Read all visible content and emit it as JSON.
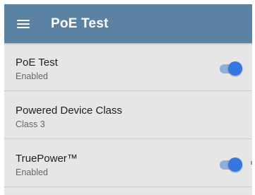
{
  "appbar": {
    "menu_icon": "hamburger-menu-icon",
    "title": "PoE Test",
    "color": "#5c82a3"
  },
  "settings": [
    {
      "title": "PoE Test",
      "subtitle": "Enabled",
      "toggle": true,
      "toggle_on": true
    },
    {
      "title": "Powered Device Class",
      "subtitle": "Class 3",
      "toggle": false
    },
    {
      "title": "TruePower™",
      "subtitle": "Enabled",
      "toggle": true,
      "toggle_on": true
    }
  ],
  "colors": {
    "background": "#e6e6e6",
    "switch_thumb": "#3676e0",
    "switch_track": "#90aedc",
    "divider": "#c9c9c9"
  }
}
